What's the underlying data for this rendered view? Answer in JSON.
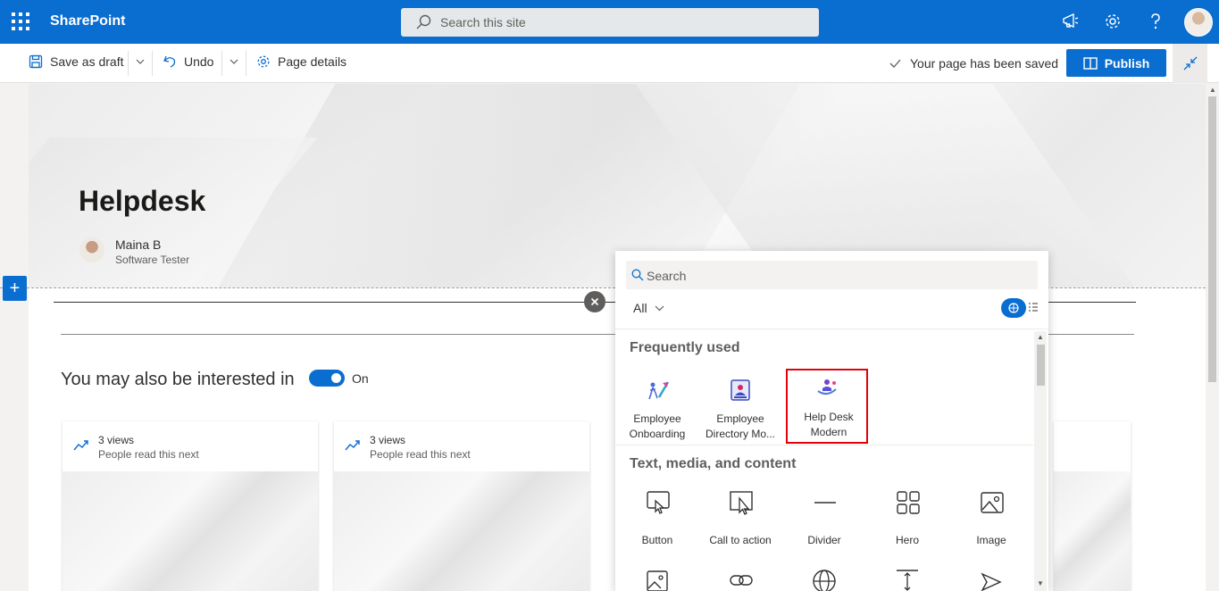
{
  "suite": {
    "app_name": "SharePoint",
    "search_placeholder": "Search this site",
    "accent": "#0a6dd0"
  },
  "command_bar": {
    "save_draft": "Save as draft",
    "undo": "Undo",
    "page_details": "Page details",
    "status": "Your page has been saved",
    "publish": "Publish"
  },
  "page": {
    "title": "Helpdesk",
    "author_name": "Maina B",
    "author_role": "Software Tester",
    "section_title": "You may also be interested in",
    "toggle_label": "On",
    "toggle_on": true
  },
  "cards": [
    {
      "views": "3 views",
      "subtitle": "People read this next"
    },
    {
      "views": "3 views",
      "subtitle": "People read this next"
    }
  ],
  "toolbox": {
    "search_placeholder": "Search",
    "filter": "All",
    "frequently_used_title": "Frequently used",
    "frequently_used": [
      {
        "label": "Employee Onboarding",
        "icon": "employee-onboarding-icon"
      },
      {
        "label": "Employee Directory Mo...",
        "icon": "employee-directory-icon"
      },
      {
        "label": "Help Desk Modern",
        "icon": "help-desk-icon",
        "selected": true
      }
    ],
    "text_media_title": "Text, media, and content",
    "text_media": [
      {
        "label": "Button",
        "icon": "button-icon"
      },
      {
        "label": "Call to action",
        "icon": "call-to-action-icon"
      },
      {
        "label": "Divider",
        "icon": "divider-icon"
      },
      {
        "label": "Hero",
        "icon": "hero-icon"
      },
      {
        "label": "Image",
        "icon": "image-icon"
      }
    ]
  }
}
